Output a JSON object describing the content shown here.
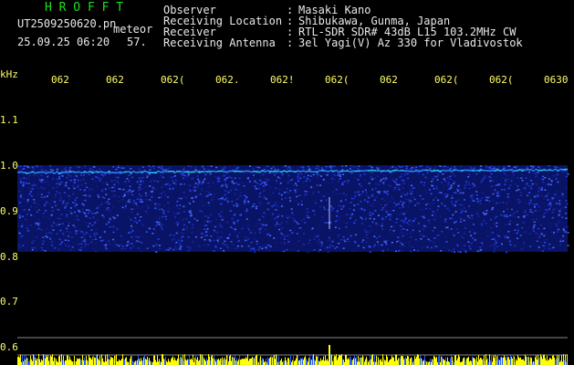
{
  "logo": "H R O F F T",
  "file_name": "UT2509250620.pn",
  "tag": "meteor",
  "datetime": "25.09.25 06:20",
  "counter": "57.",
  "info": [
    {
      "label": "Observer",
      "value": "Masaki Kano"
    },
    {
      "label": "Receiving Location",
      "value": "Shibukawa, Gunma, Japan"
    },
    {
      "label": "Receiver",
      "value": "RTL-SDR SDR# 43dB L15 103.2MHz CW"
    },
    {
      "label": "Receiving Antenna",
      "value": "3el Yagi(V) Az 330 for Vladivostok"
    }
  ],
  "separator": ":",
  "y_axis": {
    "unit": "kHz",
    "ticks": [
      "1.1",
      "1.0",
      "0.9",
      "0.8",
      "0.7",
      "0.6"
    ],
    "values": [
      1.1,
      1.0,
      0.9,
      0.8,
      0.7,
      0.6
    ]
  },
  "x_axis": {
    "ticks": [
      "062",
      "062",
      "062(",
      "062.",
      "062!",
      "062(",
      "062",
      "062(",
      "062(",
      "0630"
    ]
  },
  "colors": {
    "background": "#000000",
    "tick_text": "#ffff66",
    "header_text": "#e8e8e8",
    "logo": "#22dd22",
    "signal_band": "#1a2aa8",
    "signal_line": "#20d0e0",
    "noise_floor": "#ffff00",
    "noise_floor_blue": "#2a5cff"
  },
  "waterfall": {
    "band_khz": [
      0.81,
      1.0
    ],
    "carrier_khz": 0.985
  }
}
